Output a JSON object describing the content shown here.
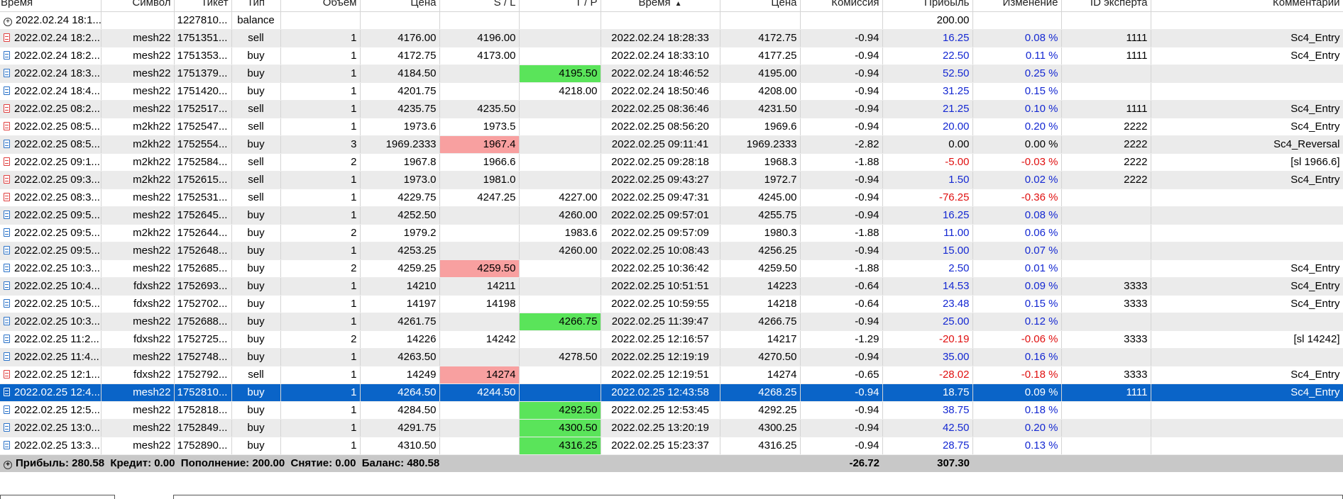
{
  "columns": [
    {
      "label": "Время",
      "align": "left"
    },
    {
      "label": "Символ",
      "align": "right"
    },
    {
      "label": "Тикет",
      "align": "right"
    },
    {
      "label": "Тип",
      "align": "center"
    },
    {
      "label": "Объем",
      "align": "right"
    },
    {
      "label": "Цена",
      "align": "right"
    },
    {
      "label": "S / L",
      "align": "right"
    },
    {
      "label": "T / P",
      "align": "right"
    },
    {
      "label": "Время",
      "align": "center",
      "sort": "▲"
    },
    {
      "label": "Цена",
      "align": "right"
    },
    {
      "label": "Комиссия",
      "align": "right"
    },
    {
      "label": "Прибыль",
      "align": "right"
    },
    {
      "label": "Изменение",
      "align": "right"
    },
    {
      "label": "ID эксперта",
      "align": "right"
    },
    {
      "label": "Комментарий",
      "align": "right"
    }
  ],
  "balance_row": {
    "icon": "plus-circle-icon",
    "time": "2022.02.24 18:1...",
    "ticket": "1227810...",
    "type": "balance",
    "profit": "200.00"
  },
  "rows": [
    {
      "dir": "sell",
      "time": "2022.02.24 18:2...",
      "symbol": "mesh22",
      "ticket": "1751351...",
      "type": "sell",
      "volume": "1",
      "price": "4176.00",
      "sl": "4196.00",
      "tp": "",
      "close_time": "2022.02.24 18:28:33",
      "close_price": "4172.75",
      "commission": "-0.94",
      "profit": "16.25",
      "change": "0.08 %",
      "expert": "1111",
      "comment": "Sc4_Entry"
    },
    {
      "dir": "buy",
      "time": "2022.02.24 18:2...",
      "symbol": "mesh22",
      "ticket": "1751353...",
      "type": "buy",
      "volume": "1",
      "price": "4172.75",
      "sl": "4173.00",
      "tp": "",
      "close_time": "2022.02.24 18:33:10",
      "close_price": "4177.25",
      "commission": "-0.94",
      "profit": "22.50",
      "change": "0.11 %",
      "expert": "1111",
      "comment": "Sc4_Entry"
    },
    {
      "dir": "buy",
      "time": "2022.02.24 18:3...",
      "symbol": "mesh22",
      "ticket": "1751379...",
      "type": "buy",
      "volume": "1",
      "price": "4184.50",
      "sl": "",
      "tp": "4195.50",
      "tp_hit": true,
      "close_time": "2022.02.24 18:46:52",
      "close_price": "4195.00",
      "commission": "-0.94",
      "profit": "52.50",
      "change": "0.25 %",
      "expert": "",
      "comment": ""
    },
    {
      "dir": "buy",
      "time": "2022.02.24 18:4...",
      "symbol": "mesh22",
      "ticket": "1751420...",
      "type": "buy",
      "volume": "1",
      "price": "4201.75",
      "sl": "",
      "tp": "4218.00",
      "close_time": "2022.02.24 18:50:46",
      "close_price": "4208.00",
      "commission": "-0.94",
      "profit": "31.25",
      "change": "0.15 %",
      "expert": "",
      "comment": ""
    },
    {
      "dir": "sell",
      "time": "2022.02.25 08:2...",
      "symbol": "mesh22",
      "ticket": "1752517...",
      "type": "sell",
      "volume": "1",
      "price": "4235.75",
      "sl": "4235.50",
      "tp": "",
      "close_time": "2022.02.25 08:36:46",
      "close_price": "4231.50",
      "commission": "-0.94",
      "profit": "21.25",
      "change": "0.10 %",
      "expert": "1111",
      "comment": "Sc4_Entry"
    },
    {
      "dir": "sell",
      "time": "2022.02.25 08:5...",
      "symbol": "m2kh22",
      "ticket": "1752547...",
      "type": "sell",
      "volume": "1",
      "price": "1973.6",
      "sl": "1973.5",
      "tp": "",
      "close_time": "2022.02.25 08:56:20",
      "close_price": "1969.6",
      "commission": "-0.94",
      "profit": "20.00",
      "change": "0.20 %",
      "expert": "2222",
      "comment": "Sc4_Entry"
    },
    {
      "dir": "buy",
      "time": "2022.02.25 08:5...",
      "symbol": "m2kh22",
      "ticket": "1752554...",
      "type": "buy",
      "volume": "3",
      "price": "1969.2333",
      "sl": "1967.4",
      "sl_hit": true,
      "tp": "",
      "close_time": "2022.02.25 09:11:41",
      "close_price": "1969.2333",
      "commission": "-2.82",
      "profit": "0.00",
      "profit_plain": true,
      "change": "0.00 %",
      "change_plain": true,
      "expert": "2222",
      "comment": "Sc4_Reversal"
    },
    {
      "dir": "sell",
      "time": "2022.02.25 09:1...",
      "symbol": "m2kh22",
      "ticket": "1752584...",
      "type": "sell",
      "volume": "2",
      "price": "1967.8",
      "sl": "1966.6",
      "tp": "",
      "close_time": "2022.02.25 09:28:18",
      "close_price": "1968.3",
      "commission": "-1.88",
      "profit": "-5.00",
      "profit_neg": true,
      "change": "-0.03 %",
      "change_neg": true,
      "expert": "2222",
      "comment": "[sl 1966.6]"
    },
    {
      "dir": "sell",
      "time": "2022.02.25 09:3...",
      "symbol": "m2kh22",
      "ticket": "1752615...",
      "type": "sell",
      "volume": "1",
      "price": "1973.0",
      "sl": "1981.0",
      "tp": "",
      "close_time": "2022.02.25 09:43:27",
      "close_price": "1972.7",
      "commission": "-0.94",
      "profit": "1.50",
      "change": "0.02 %",
      "expert": "2222",
      "comment": "Sc4_Entry"
    },
    {
      "dir": "sell",
      "time": "2022.02.25 08:3...",
      "symbol": "mesh22",
      "ticket": "1752531...",
      "type": "sell",
      "volume": "1",
      "price": "4229.75",
      "sl": "4247.25",
      "tp": "4227.00",
      "close_time": "2022.02.25 09:47:31",
      "close_price": "4245.00",
      "commission": "-0.94",
      "profit": "-76.25",
      "profit_neg": true,
      "change": "-0.36 %",
      "change_neg": true,
      "expert": "",
      "comment": ""
    },
    {
      "dir": "buy",
      "time": "2022.02.25 09:5...",
      "symbol": "mesh22",
      "ticket": "1752645...",
      "type": "buy",
      "volume": "1",
      "price": "4252.50",
      "sl": "",
      "tp": "4260.00",
      "close_time": "2022.02.25 09:57:01",
      "close_price": "4255.75",
      "commission": "-0.94",
      "profit": "16.25",
      "change": "0.08 %",
      "expert": "",
      "comment": ""
    },
    {
      "dir": "buy",
      "time": "2022.02.25 09:5...",
      "symbol": "m2kh22",
      "ticket": "1752644...",
      "type": "buy",
      "volume": "2",
      "price": "1979.2",
      "sl": "",
      "tp": "1983.6",
      "close_time": "2022.02.25 09:57:09",
      "close_price": "1980.3",
      "commission": "-1.88",
      "profit": "11.00",
      "change": "0.06 %",
      "expert": "",
      "comment": ""
    },
    {
      "dir": "buy",
      "time": "2022.02.25 09:5...",
      "symbol": "mesh22",
      "ticket": "1752648...",
      "type": "buy",
      "volume": "1",
      "price": "4253.25",
      "sl": "",
      "tp": "4260.00",
      "close_time": "2022.02.25 10:08:43",
      "close_price": "4256.25",
      "commission": "-0.94",
      "profit": "15.00",
      "change": "0.07 %",
      "expert": "",
      "comment": ""
    },
    {
      "dir": "buy",
      "time": "2022.02.25 10:3...",
      "symbol": "mesh22",
      "ticket": "1752685...",
      "type": "buy",
      "volume": "2",
      "price": "4259.25",
      "sl": "4259.50",
      "sl_hit": true,
      "tp": "",
      "close_time": "2022.02.25 10:36:42",
      "close_price": "4259.50",
      "commission": "-1.88",
      "profit": "2.50",
      "change": "0.01 %",
      "expert": "",
      "comment": "Sc4_Entry"
    },
    {
      "dir": "buy",
      "time": "2022.02.25 10:4...",
      "symbol": "fdxsh22",
      "ticket": "1752693...",
      "type": "buy",
      "volume": "1",
      "price": "14210",
      "sl": "14211",
      "tp": "",
      "close_time": "2022.02.25 10:51:51",
      "close_price": "14223",
      "commission": "-0.64",
      "profit": "14.53",
      "change": "0.09 %",
      "expert": "3333",
      "comment": "Sc4_Entry"
    },
    {
      "dir": "buy",
      "time": "2022.02.25 10:5...",
      "symbol": "fdxsh22",
      "ticket": "1752702...",
      "type": "buy",
      "volume": "1",
      "price": "14197",
      "sl": "14198",
      "tp": "",
      "close_time": "2022.02.25 10:59:55",
      "close_price": "14218",
      "commission": "-0.64",
      "profit": "23.48",
      "change": "0.15 %",
      "expert": "3333",
      "comment": "Sc4_Entry"
    },
    {
      "dir": "buy",
      "time": "2022.02.25 10:3...",
      "symbol": "mesh22",
      "ticket": "1752688...",
      "type": "buy",
      "volume": "1",
      "price": "4261.75",
      "sl": "",
      "tp": "4266.75",
      "tp_hit": true,
      "close_time": "2022.02.25 11:39:47",
      "close_price": "4266.75",
      "commission": "-0.94",
      "profit": "25.00",
      "change": "0.12 %",
      "expert": "",
      "comment": ""
    },
    {
      "dir": "buy",
      "time": "2022.02.25 11:2...",
      "symbol": "fdxsh22",
      "ticket": "1752725...",
      "type": "buy",
      "volume": "2",
      "price": "14226",
      "sl": "14242",
      "tp": "",
      "close_time": "2022.02.25 12:16:57",
      "close_price": "14217",
      "commission": "-1.29",
      "profit": "-20.19",
      "profit_neg": true,
      "change": "-0.06 %",
      "change_neg": true,
      "expert": "3333",
      "comment": "[sl 14242]"
    },
    {
      "dir": "buy",
      "time": "2022.02.25 11:4...",
      "symbol": "mesh22",
      "ticket": "1752748...",
      "type": "buy",
      "volume": "1",
      "price": "4263.50",
      "sl": "",
      "tp": "4278.50",
      "close_time": "2022.02.25 12:19:19",
      "close_price": "4270.50",
      "commission": "-0.94",
      "profit": "35.00",
      "change": "0.16 %",
      "expert": "",
      "comment": ""
    },
    {
      "dir": "sell",
      "time": "2022.02.25 12:1...",
      "symbol": "fdxsh22",
      "ticket": "1752792...",
      "type": "sell",
      "volume": "1",
      "price": "14249",
      "sl": "14274",
      "sl_hit": true,
      "tp": "",
      "close_time": "2022.02.25 12:19:51",
      "close_price": "14274",
      "commission": "-0.65",
      "profit": "-28.02",
      "profit_neg": true,
      "change": "-0.18 %",
      "change_neg": true,
      "expert": "3333",
      "comment": "Sc4_Entry"
    },
    {
      "dir": "buy",
      "time": "2022.02.25 12:4...",
      "symbol": "mesh22",
      "ticket": "1752810...",
      "type": "buy",
      "volume": "1",
      "price": "4264.50",
      "sl": "4244.50",
      "tp": "",
      "close_time": "2022.02.25 12:43:58",
      "close_price": "4268.25",
      "commission": "-0.94",
      "profit": "18.75",
      "change": "0.09 %",
      "expert": "1111",
      "comment": "Sc4_Entry",
      "selected": true
    },
    {
      "dir": "buy",
      "time": "2022.02.25 12:5...",
      "symbol": "mesh22",
      "ticket": "1752818...",
      "type": "buy",
      "volume": "1",
      "price": "4284.50",
      "sl": "",
      "tp": "4292.50",
      "tp_hit": true,
      "close_time": "2022.02.25 12:53:45",
      "close_price": "4292.25",
      "commission": "-0.94",
      "profit": "38.75",
      "change": "0.18 %",
      "expert": "",
      "comment": ""
    },
    {
      "dir": "buy",
      "time": "2022.02.25 13:0...",
      "symbol": "mesh22",
      "ticket": "1752849...",
      "type": "buy",
      "volume": "1",
      "price": "4291.75",
      "sl": "",
      "tp": "4300.50",
      "tp_hit": true,
      "close_time": "2022.02.25 13:20:19",
      "close_price": "4300.25",
      "commission": "-0.94",
      "profit": "42.50",
      "change": "0.20 %",
      "expert": "",
      "comment": ""
    },
    {
      "dir": "buy",
      "time": "2022.02.25 13:3...",
      "symbol": "mesh22",
      "ticket": "1752890...",
      "type": "buy",
      "volume": "1",
      "price": "4310.50",
      "sl": "",
      "tp": "4316.25",
      "tp_hit": true,
      "close_time": "2022.02.25 15:23:37",
      "close_price": "4316.25",
      "commission": "-0.94",
      "profit": "28.75",
      "change": "0.13 %",
      "expert": "",
      "comment": ""
    }
  ],
  "footer": {
    "summary": "Прибыль: 280.58  Кредит: 0.00  Пополнение: 200.00  Снятие: 0.00  Баланс: 480.58",
    "commission_total": "-26.72",
    "profit_total": "307.30"
  },
  "colors": {
    "selected_row": "#0a64c8",
    "tp_hit": "#5ae45a",
    "sl_hit": "#f8a0a0",
    "negative": "#e01010",
    "positive": "#1428d2",
    "footer_bg": "#c8c8c8"
  }
}
